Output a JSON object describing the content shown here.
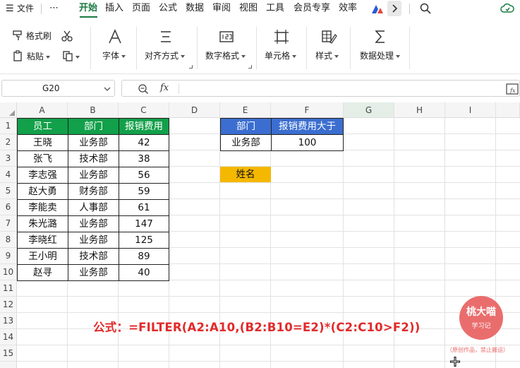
{
  "menu": {
    "items": [
      "文件",
      "开始",
      "插入",
      "页面",
      "公式",
      "数据",
      "审阅",
      "视图",
      "工具",
      "会员专享",
      "效率"
    ],
    "more": "⋯",
    "active": "开始",
    "accent": "#1a7a43"
  },
  "ribbon": {
    "format_painter": "格式刷",
    "paste": "粘贴",
    "font": "字体",
    "align": "对齐方式",
    "number_format": "数字格式",
    "cell": "单元格",
    "style": "样式",
    "data_processing": "数据处理"
  },
  "formula_bar": {
    "name_box": "G20",
    "fx": "fx",
    "formula": ""
  },
  "columns": [
    "A",
    "B",
    "C",
    "D",
    "E",
    "F",
    "G",
    "H",
    "I"
  ],
  "selected_column": "G",
  "rows": [
    "1",
    "2",
    "3",
    "4",
    "5",
    "6",
    "7",
    "8",
    "9",
    "10",
    "11",
    "12",
    "13",
    "14",
    "15"
  ],
  "table": {
    "headers": [
      "员工",
      "部门",
      "报销费用"
    ],
    "rows": [
      [
        "王晓",
        "业务部",
        "42"
      ],
      [
        "张飞",
        "技术部",
        "38"
      ],
      [
        "李志强",
        "业务部",
        "56"
      ],
      [
        "赵大勇",
        "财务部",
        "59"
      ],
      [
        "李能卖",
        "人事部",
        "61"
      ],
      [
        "朱光潞",
        "业务部",
        "147"
      ],
      [
        "李晓红",
        "业务部",
        "125"
      ],
      [
        "王小明",
        "技术部",
        "89"
      ],
      [
        "赵寻",
        "业务部",
        "40"
      ]
    ],
    "header_color": "#12a04a"
  },
  "criteria": {
    "headers": [
      "部门",
      "报销费用大于"
    ],
    "values": [
      "业务部",
      "100"
    ],
    "header_color": "#3b6ed0"
  },
  "result_header": {
    "label": "姓名",
    "color": "#f5b800"
  },
  "caption": "公式：=FILTER(A2:A10,(B2:B10=E2)*(C2:C10>F2))",
  "watermark": {
    "title": "桃大喵",
    "subtitle": "学习记",
    "note": "（原创作品，禁止搬运）"
  }
}
